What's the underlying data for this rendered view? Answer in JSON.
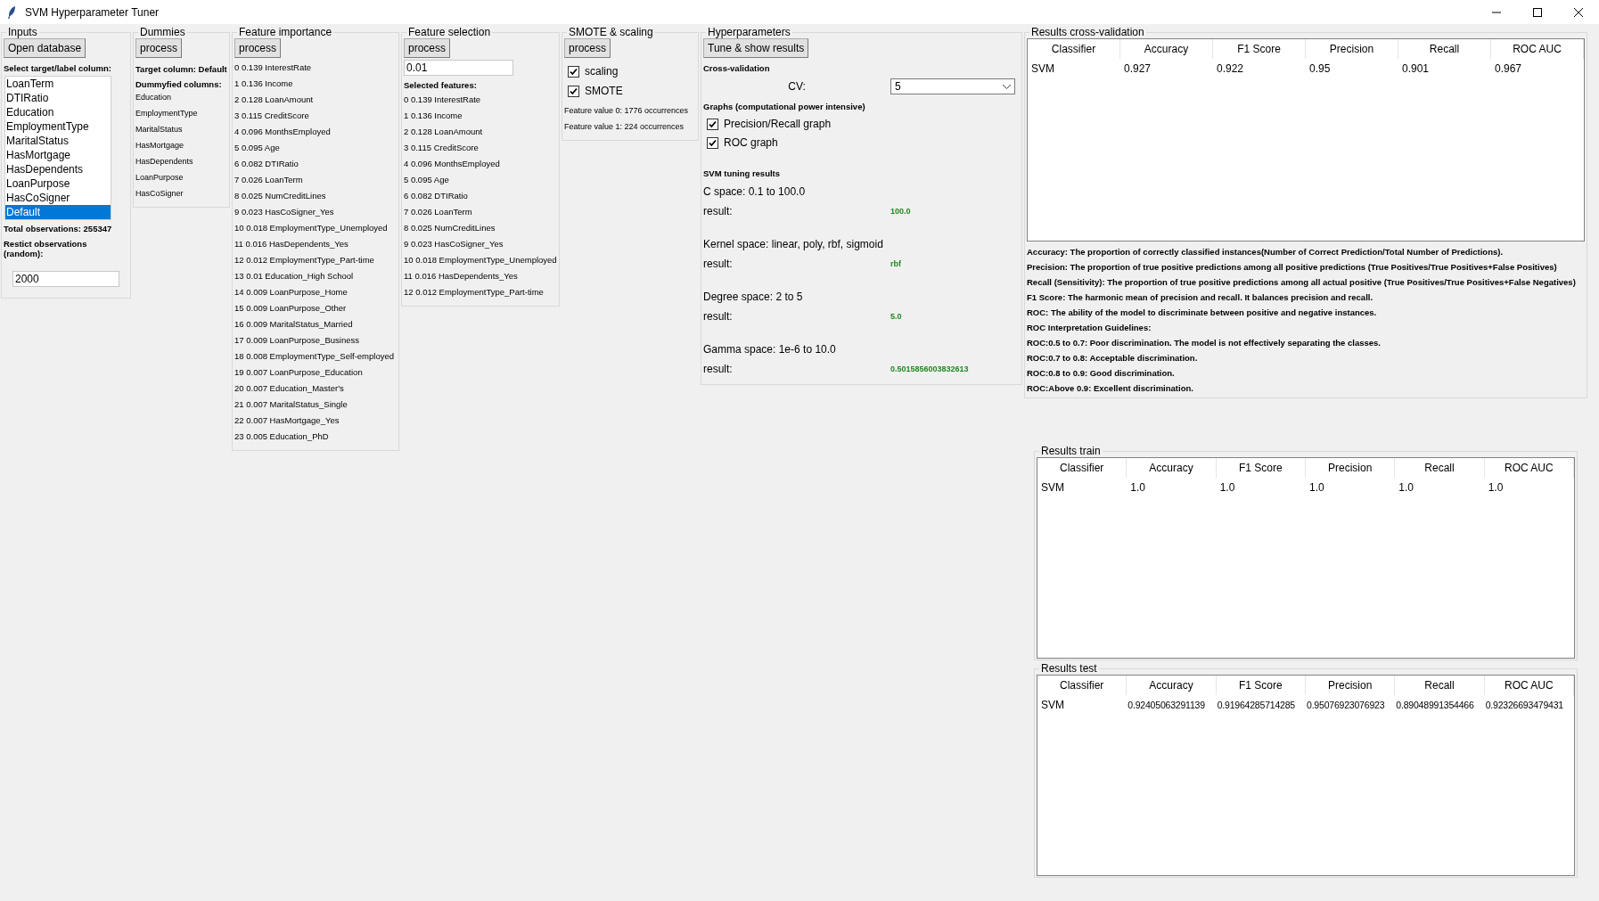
{
  "window": {
    "title": "SVM Hyperparameter Tuner"
  },
  "inputs": {
    "title": "Inputs",
    "button": "Open database",
    "select_label": "Select target/label column:",
    "columns": [
      {
        "label": "LoanTerm",
        "selected": false
      },
      {
        "label": "DTIRatio",
        "selected": false
      },
      {
        "label": "Education",
        "selected": false
      },
      {
        "label": "EmploymentType",
        "selected": false
      },
      {
        "label": "MaritalStatus",
        "selected": false
      },
      {
        "label": "HasMortgage",
        "selected": false
      },
      {
        "label": "HasDependents",
        "selected": false
      },
      {
        "label": "LoanPurpose",
        "selected": false
      },
      {
        "label": "HasCoSigner",
        "selected": false
      },
      {
        "label": "Default",
        "selected": true
      }
    ],
    "total": "Total observations: 255347",
    "restrict_label": "Restict observations (random):",
    "restrict_value": "2000"
  },
  "dummies": {
    "title": "Dummies",
    "button": "process",
    "target": "Target column: Default",
    "dummified_label": "Dummyfied columns:",
    "columns": [
      "Education",
      "EmploymentType",
      "MaritalStatus",
      "HasMortgage",
      "HasDependents",
      "LoanPurpose",
      "HasCoSigner"
    ]
  },
  "feature_importance": {
    "title": "Feature importance",
    "button": "process",
    "items": [
      "0 0.139 InterestRate",
      "1 0.136 Income",
      "2 0.128 LoanAmount",
      "3 0.115 CreditScore",
      "4 0.096 MonthsEmployed",
      "5 0.095 Age",
      "6 0.082 DTIRatio",
      "7 0.026 LoanTerm",
      "8 0.025 NumCreditLines",
      "9 0.023 HasCoSigner_Yes",
      "10 0.018 EmploymentType_Unemployed",
      "11 0.016 HasDependents_Yes",
      "12 0.012 EmploymentType_Part-time",
      "13 0.01 Education_High School",
      "14 0.009 LoanPurpose_Home",
      "15 0.009 LoanPurpose_Other",
      "16 0.009 MaritalStatus_Married",
      "17 0.009 LoanPurpose_Business",
      "18 0.008 EmploymentType_Self-employed",
      "19 0.007 LoanPurpose_Education",
      "20 0.007 Education_Master's",
      "21 0.007 MaritalStatus_Single",
      "22 0.007 HasMortgage_Yes",
      "23 0.005 Education_PhD"
    ]
  },
  "feature_selection": {
    "title": "Feature selection",
    "button": "process",
    "threshold": "0.01",
    "selected_label": "Selected features:",
    "items": [
      "0 0.139 InterestRate",
      "1 0.136 Income",
      "2 0.128 LoanAmount",
      "3 0.115 CreditScore",
      "4 0.096 MonthsEmployed",
      "5 0.095 Age",
      "6 0.082 DTIRatio",
      "7 0.026 LoanTerm",
      "8 0.025 NumCreditLines",
      "9 0.023 HasCoSigner_Yes",
      "10 0.018 EmploymentType_Unemployed",
      "11 0.016 HasDependents_Yes",
      "12 0.012 EmploymentType_Part-time"
    ]
  },
  "smote_scaling": {
    "title": "SMOTE & scaling",
    "button": "process",
    "options": [
      {
        "label": "scaling",
        "checked": true
      },
      {
        "label": "SMOTE",
        "checked": true
      }
    ],
    "counts": [
      "Feature value 0: 1776 occurrences",
      "Feature value 1: 224 occurrences"
    ]
  },
  "hyperparameters": {
    "title": "Hyperparameters",
    "button": "Tune & show results",
    "cv_heading": "Cross-validation",
    "cv_label": "CV:",
    "cv_value": "5",
    "graphs_heading": "Graphs (computational power intensive)",
    "graphs": [
      {
        "label": "Precision/Recall graph",
        "checked": true
      },
      {
        "label": "ROC graph",
        "checked": true
      }
    ],
    "tuning_heading": "SVM tuning results",
    "spaces": [
      {
        "space": "C space: 0.1 to 100.0",
        "result_label": "result:",
        "result": "100.0"
      },
      {
        "space": "Kernel space: linear, poly, rbf, sigmoid",
        "result_label": "result:",
        "result": "rbf"
      },
      {
        "space": "Degree space: 2 to 5",
        "result_label": "result:",
        "result": "5.0"
      },
      {
        "space": "Gamma space: 1e-6 to 10.0",
        "result_label": "result:",
        "result": "0.5015856003832613"
      }
    ]
  },
  "results_cross_validation": {
    "title": "Results cross-validation",
    "columns": [
      "Classifier",
      "Accuracy",
      "F1 Score",
      "Precision",
      "Recall",
      "ROC AUC"
    ],
    "rows": [
      [
        "SVM",
        "0.927",
        "0.922",
        "0.95",
        "0.901",
        "0.967"
      ]
    ],
    "notes": [
      "Accuracy: The proportion of correctly classified instances(Number of Correct Prediction/Total Number of Predictions).",
      "Precision: The proportion of true positive predictions among all positive predictions (True Positives/True Positives+False Positives)",
      "Recall (Sensitivity): The proportion of true positive predictions among all actual positive (True Positives/True Positives+False Negatives)",
      "F1 Score: The harmonic mean of precision and recall. It balances precision and recall.",
      "ROC: The ability of the model to discriminate between positive and negative instances.",
      "ROC Interpretation Guidelines:",
      "ROC:0.5 to 0.7: Poor discrimination. The model is not effectively separating the classes.",
      "ROC:0.7 to 0.8: Acceptable discrimination.",
      "ROC:0.8 to 0.9: Good discrimination.",
      "ROC:Above 0.9: Excellent discrimination."
    ]
  },
  "results_train": {
    "title": "Results train",
    "columns": [
      "Classifier",
      "Accuracy",
      "F1 Score",
      "Precision",
      "Recall",
      "ROC AUC"
    ],
    "rows": [
      [
        "SVM",
        "1.0",
        "1.0",
        "1.0",
        "1.0",
        "1.0"
      ]
    ]
  },
  "results_test": {
    "title": "Results test",
    "columns": [
      "Classifier",
      "Accuracy",
      "F1 Score",
      "Precision",
      "Recall",
      "ROC AUC"
    ],
    "rows": [
      [
        "SVM",
        "0.92405063291139",
        "0.91964285714285",
        "0.95076923076923",
        "0.89048991354466",
        "0.92326693479431"
      ]
    ]
  }
}
